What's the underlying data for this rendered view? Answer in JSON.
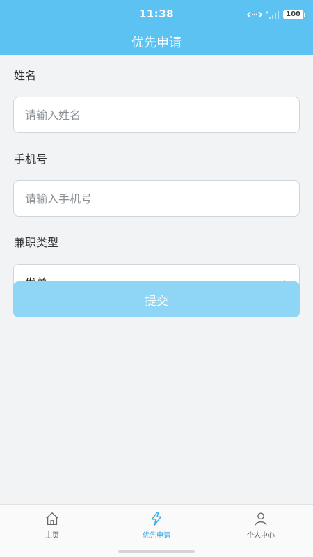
{
  "status_bar": {
    "time": "11:38",
    "battery": "100"
  },
  "header": {
    "title": "优先申请"
  },
  "form": {
    "name_label": "姓名",
    "name_placeholder": "请输入姓名",
    "name_value": "",
    "phone_label": "手机号",
    "phone_placeholder": "请输入手机号",
    "phone_value": "",
    "type_label": "兼职类型",
    "type_value": "发单",
    "submit_label": "提交"
  },
  "tabs": [
    {
      "label": "主页",
      "icon": "home-icon"
    },
    {
      "label": "优先申请",
      "icon": "lightning-icon",
      "active": true
    },
    {
      "label": "个人中心",
      "icon": "person-icon"
    }
  ],
  "colors": {
    "primary": "#5bc2f2",
    "submit_disabled": "#8fd5f5",
    "active_tab": "#3da9e6"
  }
}
